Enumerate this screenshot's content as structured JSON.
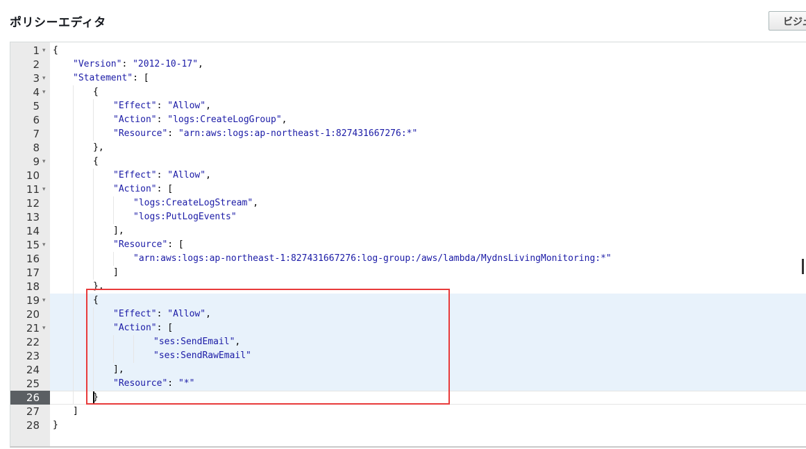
{
  "header": {
    "title": "ポリシーエディタ",
    "visual_editor_button": "ビジュ"
  },
  "editor": {
    "active_line": 26,
    "highlighted_lines": [
      19,
      20,
      21,
      22,
      23,
      24,
      25,
      26
    ],
    "lines": [
      {
        "n": "1",
        "fold": true,
        "indent": 0,
        "tokens": [
          [
            "p",
            "{"
          ]
        ]
      },
      {
        "n": "2",
        "fold": false,
        "indent": 1,
        "tokens": [
          [
            "key",
            "\"Version\""
          ],
          [
            "p",
            ": "
          ],
          [
            "str",
            "\"2012-10-17\""
          ],
          [
            "p",
            ","
          ]
        ]
      },
      {
        "n": "3",
        "fold": true,
        "indent": 1,
        "tokens": [
          [
            "key",
            "\"Statement\""
          ],
          [
            "p",
            ": ["
          ]
        ]
      },
      {
        "n": "4",
        "fold": true,
        "indent": 2,
        "tokens": [
          [
            "p",
            "{"
          ]
        ]
      },
      {
        "n": "5",
        "fold": false,
        "indent": 3,
        "tokens": [
          [
            "key",
            "\"Effect\""
          ],
          [
            "p",
            ": "
          ],
          [
            "str",
            "\"Allow\""
          ],
          [
            "p",
            ","
          ]
        ]
      },
      {
        "n": "6",
        "fold": false,
        "indent": 3,
        "tokens": [
          [
            "key",
            "\"Action\""
          ],
          [
            "p",
            ": "
          ],
          [
            "str",
            "\"logs:CreateLogGroup\""
          ],
          [
            "p",
            ","
          ]
        ]
      },
      {
        "n": "7",
        "fold": false,
        "indent": 3,
        "tokens": [
          [
            "key",
            "\"Resource\""
          ],
          [
            "p",
            ": "
          ],
          [
            "str",
            "\"arn:aws:logs:ap-northeast-1:827431667276:*\""
          ]
        ]
      },
      {
        "n": "8",
        "fold": false,
        "indent": 2,
        "tokens": [
          [
            "p",
            "},"
          ]
        ]
      },
      {
        "n": "9",
        "fold": true,
        "indent": 2,
        "tokens": [
          [
            "p",
            "{"
          ]
        ]
      },
      {
        "n": "10",
        "fold": false,
        "indent": 3,
        "tokens": [
          [
            "key",
            "\"Effect\""
          ],
          [
            "p",
            ": "
          ],
          [
            "str",
            "\"Allow\""
          ],
          [
            "p",
            ","
          ]
        ]
      },
      {
        "n": "11",
        "fold": true,
        "indent": 3,
        "tokens": [
          [
            "key",
            "\"Action\""
          ],
          [
            "p",
            ": ["
          ]
        ]
      },
      {
        "n": "12",
        "fold": false,
        "indent": 4,
        "tokens": [
          [
            "str",
            "\"logs:CreateLogStream\""
          ],
          [
            "p",
            ","
          ]
        ]
      },
      {
        "n": "13",
        "fold": false,
        "indent": 4,
        "tokens": [
          [
            "str",
            "\"logs:PutLogEvents\""
          ]
        ]
      },
      {
        "n": "14",
        "fold": false,
        "indent": 3,
        "tokens": [
          [
            "p",
            "],"
          ]
        ]
      },
      {
        "n": "15",
        "fold": true,
        "indent": 3,
        "tokens": [
          [
            "key",
            "\"Resource\""
          ],
          [
            "p",
            ": ["
          ]
        ]
      },
      {
        "n": "16",
        "fold": false,
        "indent": 4,
        "tokens": [
          [
            "str",
            "\"arn:aws:logs:ap-northeast-1:827431667276:log-group:/aws/lambda/MydnsLivingMonitoring:*\""
          ]
        ]
      },
      {
        "n": "17",
        "fold": false,
        "indent": 3,
        "tokens": [
          [
            "p",
            "]"
          ]
        ]
      },
      {
        "n": "18",
        "fold": false,
        "indent": 2,
        "tokens": [
          [
            "p",
            "},"
          ]
        ]
      },
      {
        "n": "19",
        "fold": true,
        "indent": 2,
        "tokens": [
          [
            "p",
            "{"
          ]
        ]
      },
      {
        "n": "20",
        "fold": false,
        "indent": 3,
        "tokens": [
          [
            "key",
            "\"Effect\""
          ],
          [
            "p",
            ": "
          ],
          [
            "str",
            "\"Allow\""
          ],
          [
            "p",
            ","
          ]
        ]
      },
      {
        "n": "21",
        "fold": true,
        "indent": 3,
        "tokens": [
          [
            "key",
            "\"Action\""
          ],
          [
            "p",
            ": ["
          ]
        ]
      },
      {
        "n": "22",
        "fold": false,
        "indent": 5,
        "tokens": [
          [
            "str",
            "\"ses:SendEmail\""
          ],
          [
            "p",
            ","
          ]
        ]
      },
      {
        "n": "23",
        "fold": false,
        "indent": 5,
        "tokens": [
          [
            "str",
            "\"ses:SendRawEmail\""
          ]
        ]
      },
      {
        "n": "24",
        "fold": false,
        "indent": 3,
        "tokens": [
          [
            "p",
            "],"
          ]
        ]
      },
      {
        "n": "25",
        "fold": false,
        "indent": 3,
        "tokens": [
          [
            "key",
            "\"Resource\""
          ],
          [
            "p",
            ": "
          ],
          [
            "str",
            "\"*\""
          ]
        ]
      },
      {
        "n": "26",
        "fold": false,
        "indent": 2,
        "tokens": [
          [
            "p",
            "}"
          ]
        ]
      },
      {
        "n": "27",
        "fold": false,
        "indent": 1,
        "tokens": [
          [
            "p",
            "]"
          ]
        ]
      },
      {
        "n": "28",
        "fold": false,
        "indent": 0,
        "tokens": [
          [
            "p",
            "}"
          ]
        ]
      }
    ]
  }
}
